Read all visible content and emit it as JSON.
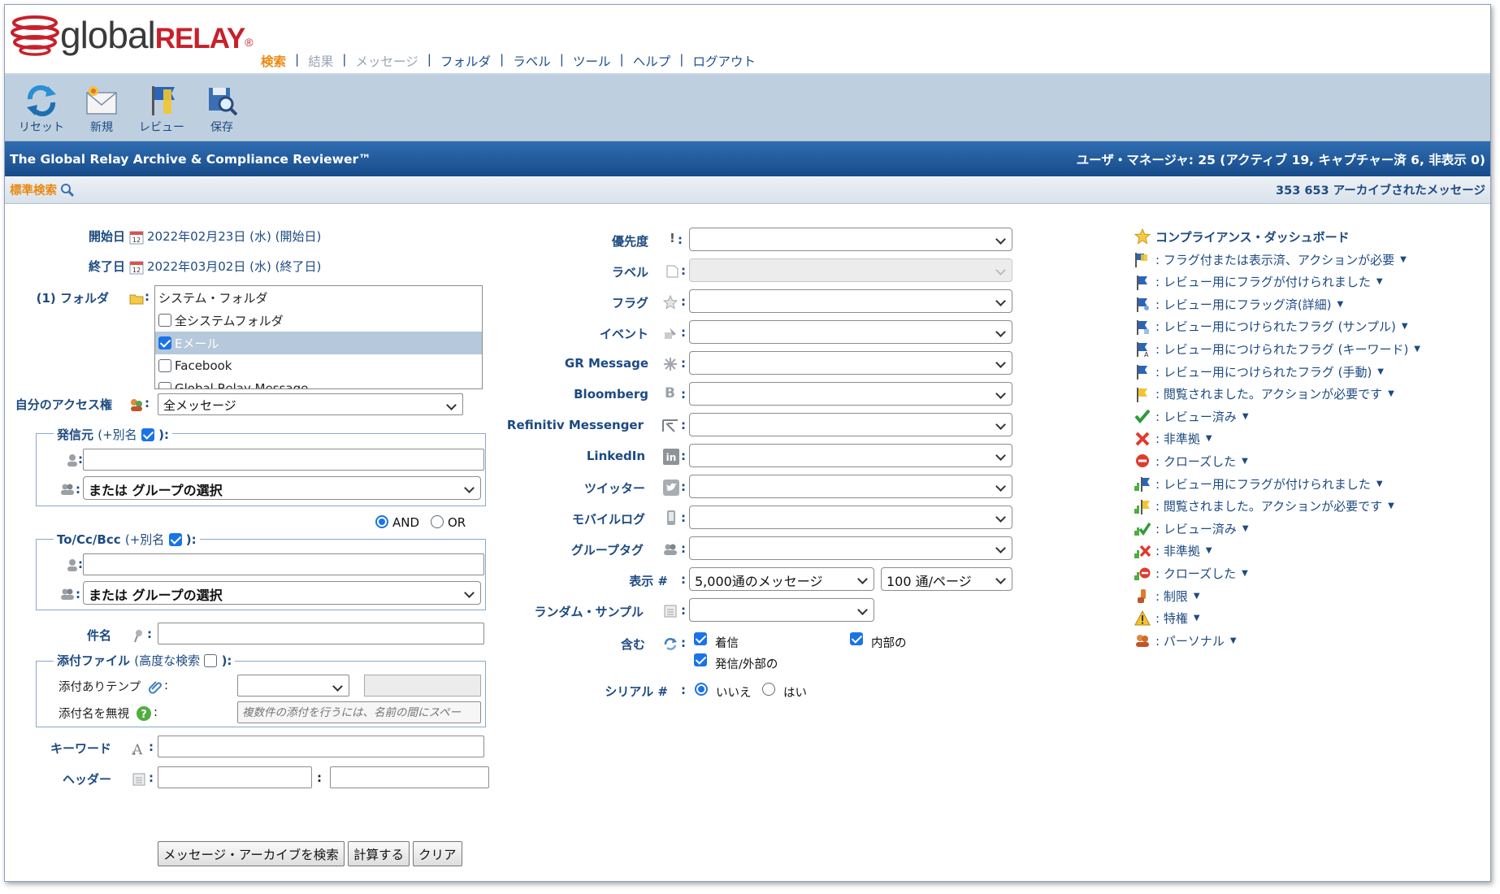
{
  "brand": {
    "global": "global",
    "relay": "RELAY",
    "reg": "®"
  },
  "nav": {
    "items": [
      {
        "label": "検索",
        "state": "active"
      },
      {
        "label": "結果",
        "state": "disabled"
      },
      {
        "label": "メッセージ",
        "state": "disabled"
      },
      {
        "label": "フォルダ",
        "state": "normal"
      },
      {
        "label": "ラベル",
        "state": "normal"
      },
      {
        "label": "ツール",
        "state": "normal"
      },
      {
        "label": "ヘルプ",
        "state": "normal"
      },
      {
        "label": "ログアウト",
        "state": "normal"
      }
    ],
    "separator": "|"
  },
  "toolbar": {
    "reset": "リセット",
    "new": "新規",
    "review": "レビュー",
    "save": "保存"
  },
  "titlebar": {
    "app_title": "The Global Relay Archive & Compliance Reviewer™",
    "user_info": "ユーザ・マネージャ: 25 (アクティブ 19, キャプチャー済 6, 非表示 0)"
  },
  "subbar": {
    "standard_search": "標準検索",
    "archived_count": "353 653 アーカイブされたメッセージ"
  },
  "form": {
    "start_date_label": "開始日",
    "start_date_value": "2022年02月23日 (水) (開始日)",
    "end_date_label": "終了日",
    "end_date_value": "2022年03月02日 (水) (終了日)",
    "folder_label": "(1) フォルダ",
    "folder_list": {
      "header": "システム・フォルダ",
      "items": [
        {
          "label": "全システムフォルダ",
          "checked": false,
          "highlighted": false
        },
        {
          "label": "Eメール",
          "checked": true,
          "highlighted": true
        },
        {
          "label": "Facebook",
          "checked": false,
          "highlighted": false
        },
        {
          "label": "Global Relay Message",
          "checked": false,
          "highlighted": false
        }
      ]
    },
    "access_label": "自分のアクセス権",
    "access_value": "全メッセージ",
    "sender_legend": "発信元",
    "sender_alias": "(+別名",
    "sender_alias_checked": true,
    "sender_group_value": "または グループの選択",
    "and_label": "AND",
    "or_label": "OR",
    "and_or_selected": "AND",
    "tocc_legend": "To/Cc/Bcc",
    "tocc_alias": "(+別名",
    "tocc_alias_checked": true,
    "tocc_group_value": "または グループの選択",
    "subject_label": "件名",
    "attach_legend": "添付ファイル",
    "attach_advanced": "(高度な検索",
    "attach_advanced_checked": false,
    "attach_temp_label": "添付ありテンプ",
    "attach_ignore_label": "添付名を無視",
    "attach_ignore_placeholder": "複数件の添付を行うには、名前の間にスペー",
    "keyword_label": "キーワード",
    "header_label": "ヘッダー",
    "colon": ":",
    "close_paren": "):",
    "buttons": {
      "search": "メッセージ・アーカイブを検索",
      "count": "計算する",
      "clear": "クリア"
    }
  },
  "middle": {
    "priority_label": "優先度",
    "label_label": "ラベル",
    "flag_label": "フラグ",
    "event_label": "イベント",
    "grmessage_label": "GR Message",
    "bloomberg_label": "Bloomberg",
    "refinitiv_label": "Refinitiv Messenger",
    "linkedin_label": "LinkedIn",
    "twitter_label": "ツイッター",
    "mobile_label": "モバイルログ",
    "grouptag_label": "グループタグ",
    "display_label": "表示 #",
    "display_value": "5,000通のメッセージ",
    "perpage_value": "100 通/ページ",
    "random_label": "ランダム・サンプル",
    "include_label": "含む",
    "include_incoming": "着信",
    "include_internal": "内部の",
    "include_outgoing": "発信/外部の",
    "serial_label": "シリアル #",
    "serial_no": "いいえ",
    "serial_yes": "はい",
    "serial_selected": "いいえ"
  },
  "dashboard": {
    "title": "コンプライアンス・ダッシュボード",
    "items": [
      {
        "label": ": フラグ付または表示済、アクションが必要",
        "icon": "blue-yellow-flag-icon"
      },
      {
        "label": ": レビュー用にフラグが付けられました",
        "icon": "blue-flag-icon"
      },
      {
        "label": ": レビュー用にフラッグ済(詳細)",
        "icon": "blue-flag-detail-icon"
      },
      {
        "label": ": レビュー用につけられたフラグ (サンプル)",
        "icon": "blue-flag-sample-icon"
      },
      {
        "label": ": レビュー用につけられたフラグ (キーワード)",
        "icon": "blue-flag-keyword-icon"
      },
      {
        "label": ": レビュー用につけられたフラグ (手動)",
        "icon": "blue-flag-manual-icon"
      },
      {
        "label": ": 閲覧されました。アクションが必要です",
        "icon": "yellow-flag-icon"
      },
      {
        "label": ": レビュー済み",
        "icon": "green-check-icon"
      },
      {
        "label": ": 非準拠",
        "icon": "red-x-icon"
      },
      {
        "label": ": クローズした",
        "icon": "red-stop-icon"
      },
      {
        "label": ": レビュー用にフラグが付けられました",
        "icon": "escalated-blue-flag-icon"
      },
      {
        "label": ": 閲覧されました。アクションが必要です",
        "icon": "escalated-yellow-flag-icon"
      },
      {
        "label": ": レビュー済み",
        "icon": "escalated-green-check-icon"
      },
      {
        "label": ": 非準拠",
        "icon": "escalated-red-x-icon"
      },
      {
        "label": ": クローズした",
        "icon": "escalated-red-stop-icon"
      },
      {
        "label": ": 制限",
        "icon": "restricted-icon"
      },
      {
        "label": ": 特権",
        "icon": "warning-icon"
      },
      {
        "label": ": パーソナル",
        "icon": "personal-icon"
      }
    ],
    "arrow": "▼"
  },
  "colors": {
    "link_blue": "#1d4a82",
    "active_orange": "#e98a12",
    "titlebar_blue": "#1f5596",
    "toolbar_bg": "#bed0e0",
    "brand_red": "#c8202b"
  }
}
